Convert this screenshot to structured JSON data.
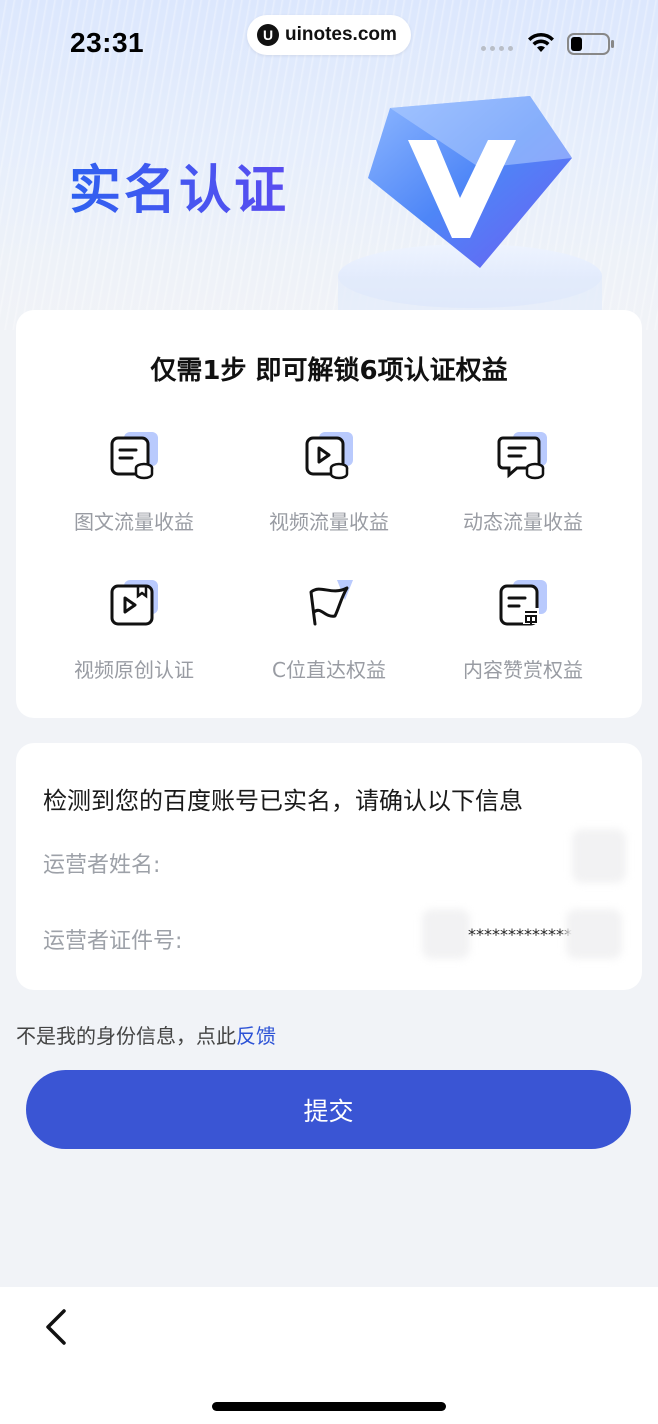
{
  "status_bar": {
    "time": "23:31",
    "url_logo": "U",
    "url_text": "uinotes.com"
  },
  "hero": {
    "title": "实名认证",
    "badge_icon": "verified-v-badge-icon"
  },
  "benefits": {
    "title": "仅需1步 即可解锁6项认证权益",
    "items": [
      {
        "label": "图文流量收益",
        "icon": "article-coins-icon"
      },
      {
        "label": "视频流量收益",
        "icon": "video-coins-icon"
      },
      {
        "label": "动态流量收益",
        "icon": "chat-coins-icon"
      },
      {
        "label": "视频原创认证",
        "icon": "video-bookmark-icon"
      },
      {
        "label": "C位直达权益",
        "icon": "flag-icon"
      },
      {
        "label": "内容赞赏权益",
        "icon": "reward-doc-icon"
      }
    ]
  },
  "info": {
    "heading": "检测到您的百度账号已实名，请确认以下信息",
    "operator_name_label": "运营者姓名:",
    "operator_id_label": "运营者证件号:",
    "operator_id_value": "*************"
  },
  "feedback": {
    "text": "不是我的身份信息，点此",
    "link": "反馈"
  },
  "submit_label": "提交",
  "colors": {
    "accent": "#3a55d4",
    "title_blue": "#2d5bea",
    "link": "#2c52d6"
  }
}
